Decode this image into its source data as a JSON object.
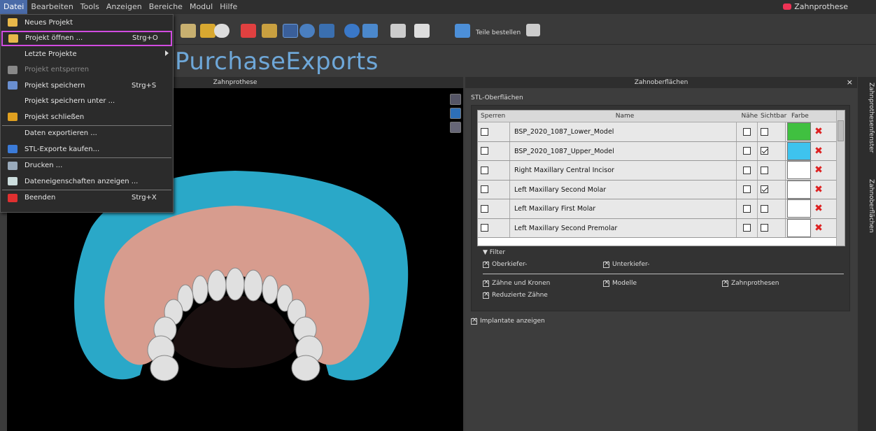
{
  "menubar": {
    "items": [
      "Datei",
      "Bearbeiten",
      "Tools",
      "Anzeigen",
      "Bereiche",
      "Modul",
      "Hilfe"
    ],
    "active": "Datei"
  },
  "app_title": "Zahnprothese",
  "toolbar": {
    "order_label": "Teile bestellen"
  },
  "logo_text": "PurchaseExports",
  "viewport": {
    "title": "Zahnprothese"
  },
  "panel": {
    "title": "Zahnoberflächen",
    "close": "×",
    "stl_label": "STL-Oberflächen",
    "columns": {
      "lock": "Sperren",
      "name": "Name",
      "near": "Nähe",
      "visible": "Sichtbar",
      "color": "Farbe"
    },
    "rows": [
      {
        "name": "BSP_2020_1087_Lower_Model",
        "locked": false,
        "near": false,
        "visible": false,
        "color": "#40c040"
      },
      {
        "name": "BSP_2020_1087_Upper_Model",
        "locked": false,
        "near": false,
        "visible": true,
        "color": "#3ec3ee"
      },
      {
        "name": "Right Maxillary Central Incisor",
        "locked": false,
        "near": false,
        "visible": false,
        "color": "#ffffff"
      },
      {
        "name": "Left Maxillary Second Molar",
        "locked": false,
        "near": false,
        "visible": true,
        "color": "#ffffff"
      },
      {
        "name": "Left Maxillary First Molar",
        "locked": false,
        "near": false,
        "visible": false,
        "color": "#ffffff"
      },
      {
        "name": "Left Maxillary Second Premolar",
        "locked": false,
        "near": false,
        "visible": false,
        "color": "#ffffff"
      }
    ],
    "filter": {
      "label": "Filter",
      "upper": "Oberkiefer-",
      "lower": "Unterkiefer-",
      "teeth": "Zähne und Kronen",
      "models": "Modelle",
      "dentures": "Zahnprothesen",
      "reduced": "Reduzierte Zähne"
    },
    "implants": "Implantate anzeigen"
  },
  "sidestrip": {
    "tab1": "Zahnprothesenfenster",
    "tab2": "Zahnoberflächen"
  },
  "datei_menu": {
    "items": [
      {
        "label": "Neues Projekt",
        "shortcut": "",
        "icon": "new-project-icon",
        "color": "#e8b84a"
      },
      {
        "label": "Projekt öffnen ...",
        "shortcut": "Strg+O",
        "icon": "folder-open-icon",
        "color": "#e8b84a"
      },
      {
        "label": "Letzte Projekte",
        "shortcut": "",
        "icon": "",
        "color": ""
      },
      {
        "label": "Projekt entsperren",
        "shortcut": "",
        "icon": "unlock-icon",
        "color": "#888888"
      },
      {
        "label": "Projekt speichern",
        "shortcut": "Strg+S",
        "icon": "save-icon",
        "color": "#6a8fd0"
      },
      {
        "label": "Projekt speichern unter ...",
        "shortcut": "",
        "icon": "",
        "color": ""
      },
      {
        "label": "Projekt schließen",
        "shortcut": "",
        "icon": "close-project-icon",
        "color": "#e0a020"
      },
      {
        "label": "Daten exportieren ...",
        "shortcut": "",
        "icon": "",
        "color": ""
      },
      {
        "label": "STL-Exporte kaufen...",
        "shortcut": "",
        "icon": "paypal-icon",
        "color": "#3b7bd8"
      },
      {
        "label": "Drucken ...",
        "shortcut": "",
        "icon": "printer-icon",
        "color": "#9ab"
      },
      {
        "label": "Dateneigenschaften anzeigen ...",
        "shortcut": "",
        "icon": "properties-icon",
        "color": "#cdd"
      },
      {
        "label": "Beenden",
        "shortcut": "Strg+X",
        "icon": "exit-icon",
        "color": "#e03030"
      }
    ]
  }
}
